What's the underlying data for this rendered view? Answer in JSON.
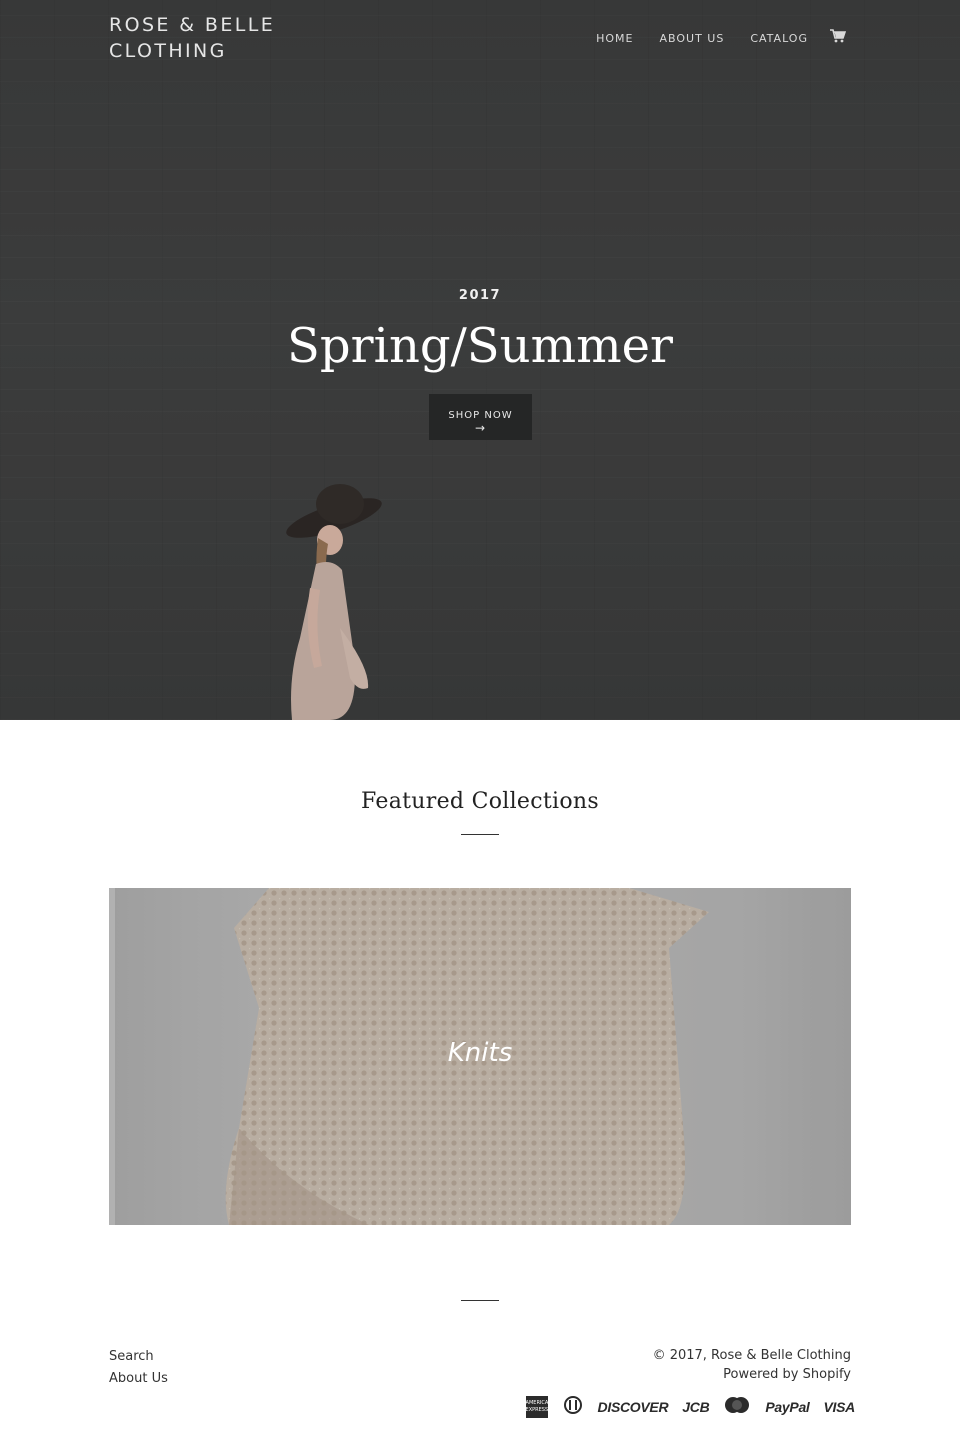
{
  "brand": {
    "name": "ROSE & BELLE CLOTHING"
  },
  "nav": {
    "items": [
      {
        "label": "HOME"
      },
      {
        "label": "ABOUT US"
      },
      {
        "label": "CATALOG"
      }
    ],
    "cart_icon": "cart-icon"
  },
  "hero": {
    "subtitle": "2017",
    "title": "Spring/Summer",
    "button_label": "SHOP NOW",
    "button_arrow": "→"
  },
  "featured": {
    "title": "Featured Collections",
    "collections": [
      {
        "label": "Knits"
      }
    ]
  },
  "footer": {
    "links": [
      {
        "label": "Search"
      },
      {
        "label": "About Us"
      }
    ],
    "copyright": "© 2017, Rose & Belle Clothing",
    "powered": "Powered by Shopify",
    "payments": [
      "AMERICAN EXPRESS",
      "Diners Club",
      "DISCOVER",
      "JCB",
      "MasterCard",
      "PayPal",
      "VISA"
    ]
  },
  "colors": {
    "hero_bg": "#434444",
    "button_bg": "#252626",
    "text": "#222222"
  }
}
